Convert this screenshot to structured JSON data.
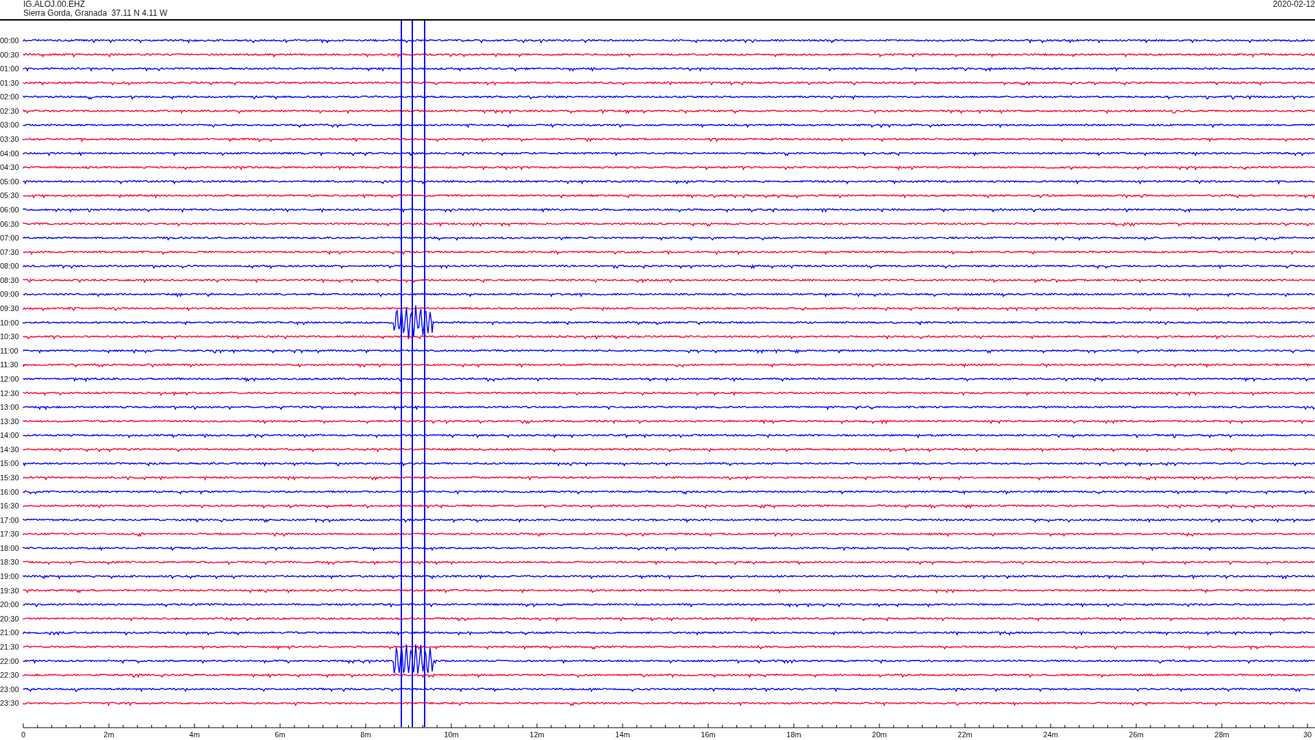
{
  "header": {
    "station": "IG.ALOJ.00.EHZ",
    "location": "Sierra Gorda, Granada  37.11 N 4.11 W",
    "date": "2020-02-12"
  },
  "traces": [
    {
      "label": "00:00",
      "color": "#0000ff",
      "event": false
    },
    {
      "label": "00:30",
      "color": "#ff0033",
      "event": false
    },
    {
      "label": "01:00",
      "color": "#0000ff",
      "event": false
    },
    {
      "label": "01:30",
      "color": "#ff0033",
      "event": false
    },
    {
      "label": "02:00",
      "color": "#0000ff",
      "event": false
    },
    {
      "label": "02:30",
      "color": "#ff0033",
      "event": false
    },
    {
      "label": "03:00",
      "color": "#0000ff",
      "event": false
    },
    {
      "label": "03:30",
      "color": "#ff0033",
      "event": false
    },
    {
      "label": "04:00",
      "color": "#0000ff",
      "event": false
    },
    {
      "label": "04:30",
      "color": "#ff0033",
      "event": false
    },
    {
      "label": "05:00",
      "color": "#0000ff",
      "event": false
    },
    {
      "label": "05:30",
      "color": "#ff0033",
      "event": false
    },
    {
      "label": "06:00",
      "color": "#0000ff",
      "event": false
    },
    {
      "label": "06:30",
      "color": "#ff0033",
      "event": false
    },
    {
      "label": "07:00",
      "color": "#0000ff",
      "event": false
    },
    {
      "label": "07:30",
      "color": "#ff0033",
      "event": false
    },
    {
      "label": "08:00",
      "color": "#0000ff",
      "event": false
    },
    {
      "label": "08:30",
      "color": "#ff0033",
      "event": false
    },
    {
      "label": "09:00",
      "color": "#0000ff",
      "event": false
    },
    {
      "label": "09:30",
      "color": "#ff0033",
      "event": false
    },
    {
      "label": "10:00",
      "color": "#0000ff",
      "event": true
    },
    {
      "label": "10:30",
      "color": "#ff0033",
      "event": false
    },
    {
      "label": "11:00",
      "color": "#0000ff",
      "event": false
    },
    {
      "label": "11:30",
      "color": "#ff0033",
      "event": false
    },
    {
      "label": "12:00",
      "color": "#0000ff",
      "event": false
    },
    {
      "label": "12:30",
      "color": "#ff0033",
      "event": false
    },
    {
      "label": "13:00",
      "color": "#0000ff",
      "event": false
    },
    {
      "label": "13:30",
      "color": "#ff0033",
      "event": false
    },
    {
      "label": "14:00",
      "color": "#0000ff",
      "event": false
    },
    {
      "label": "14:30",
      "color": "#ff0033",
      "event": false
    },
    {
      "label": "15:00",
      "color": "#0000ff",
      "event": false
    },
    {
      "label": "15:30",
      "color": "#ff0033",
      "event": false
    },
    {
      "label": "16:00",
      "color": "#0000ff",
      "event": false
    },
    {
      "label": "16:30",
      "color": "#ff0033",
      "event": false
    },
    {
      "label": "17:00",
      "color": "#0000ff",
      "event": false
    },
    {
      "label": "17:30",
      "color": "#ff0033",
      "event": false
    },
    {
      "label": "18:00",
      "color": "#0000ff",
      "event": false
    },
    {
      "label": "18:30",
      "color": "#ff0033",
      "event": false
    },
    {
      "label": "19:00",
      "color": "#0000ff",
      "event": false
    },
    {
      "label": "19:30",
      "color": "#ff0033",
      "event": false
    },
    {
      "label": "20:00",
      "color": "#0000ff",
      "event": false
    },
    {
      "label": "20:30",
      "color": "#ff0033",
      "event": false
    },
    {
      "label": "21:00",
      "color": "#0000ff",
      "event": false
    },
    {
      "label": "21:30",
      "color": "#ff0033",
      "event": false
    },
    {
      "label": "22:00",
      "color": "#0000ff",
      "event": true
    },
    {
      "label": "22:30",
      "color": "#ff0033",
      "event": false
    },
    {
      "label": "23:00",
      "color": "#0000ff",
      "event": false
    },
    {
      "label": "23:30",
      "color": "#ff0033",
      "event": false
    }
  ],
  "x_axis": {
    "ticks": [
      "0",
      "2m",
      "4m",
      "6m",
      "8m",
      "10m",
      "12m",
      "14m",
      "16m",
      "18m",
      "20m",
      "22m",
      "24m",
      "26m",
      "28m",
      "30"
    ]
  }
}
